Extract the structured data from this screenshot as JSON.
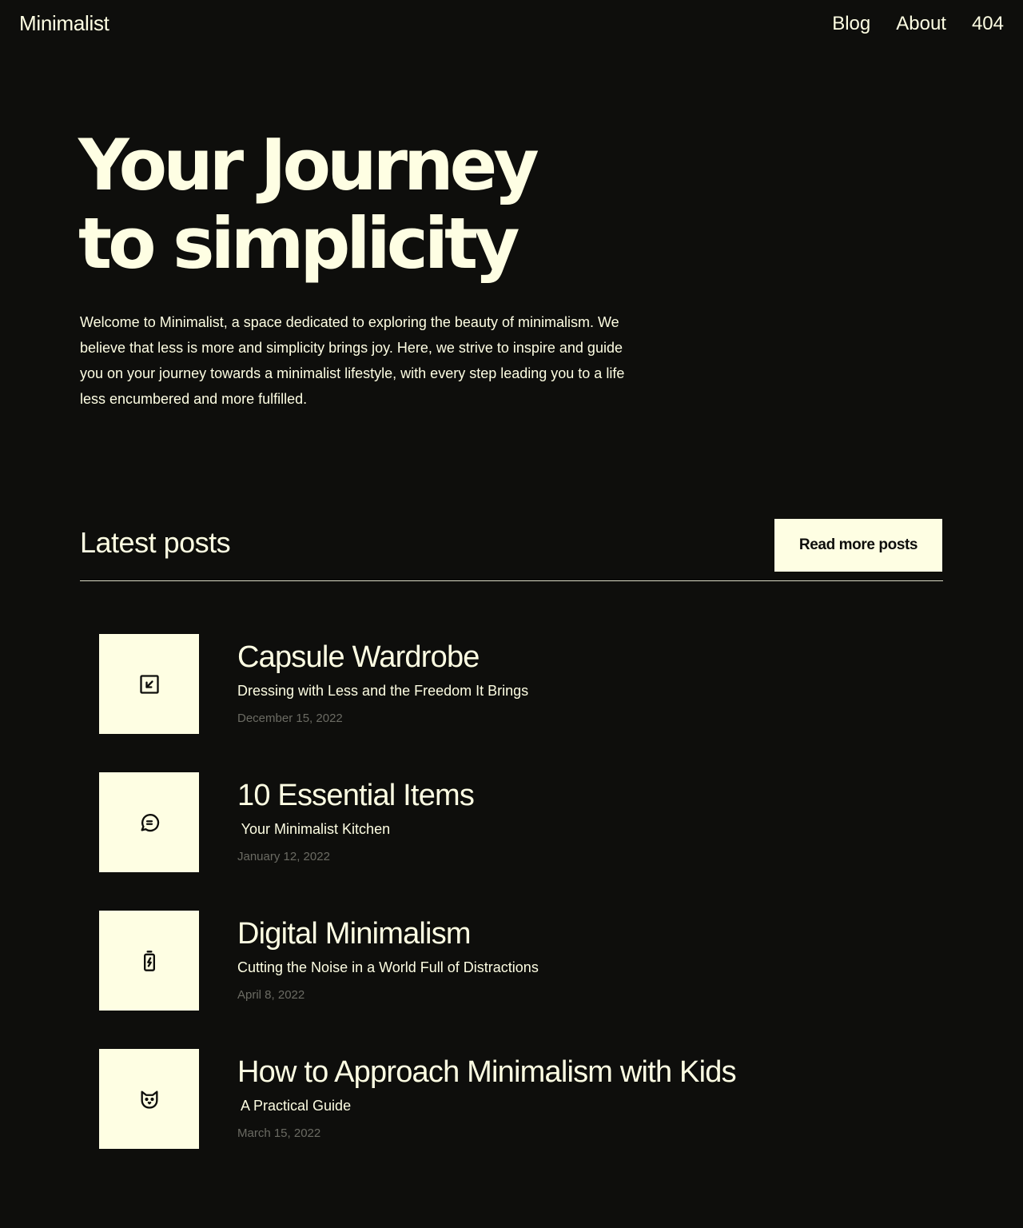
{
  "header": {
    "brand": "Minimalist",
    "nav": [
      "Blog",
      "About",
      "404"
    ]
  },
  "hero": {
    "title_line1": "Your Journey",
    "title_line2": "to simplicity",
    "intro": "Welcome to Minimalist, a space dedicated to exploring the beauty of minimalism. We believe that less is more and simplicity brings joy. Here, we strive to inspire and guide you on your journey towards a minimalist lifestyle, with every step leading you to a life less encumbered and more fulfilled."
  },
  "latest": {
    "title": "Latest posts",
    "button_label": "Read more posts"
  },
  "posts": [
    {
      "title": "Capsule Wardrobe",
      "subtitle": "Dressing with Less and the Freedom It Brings",
      "date": "December 15, 2022",
      "icon": "arrow-down-left-square-icon"
    },
    {
      "title": "10 Essential Items",
      "subtitle": " Your Minimalist Kitchen",
      "date": "January 12, 2022",
      "icon": "message-circle-icon"
    },
    {
      "title": "Digital Minimalism",
      "subtitle": "Cutting the Noise in a World Full of Distractions",
      "date": "April 8, 2022",
      "icon": "battery-charging-icon"
    },
    {
      "title": "How to Approach Minimalism with Kids",
      "subtitle": " A Practical Guide",
      "date": "March 15, 2022",
      "icon": "cat-icon"
    }
  ],
  "colors": {
    "background": "#0e0e0c",
    "foreground": "#fefee3",
    "muted": "#6b6b63"
  }
}
